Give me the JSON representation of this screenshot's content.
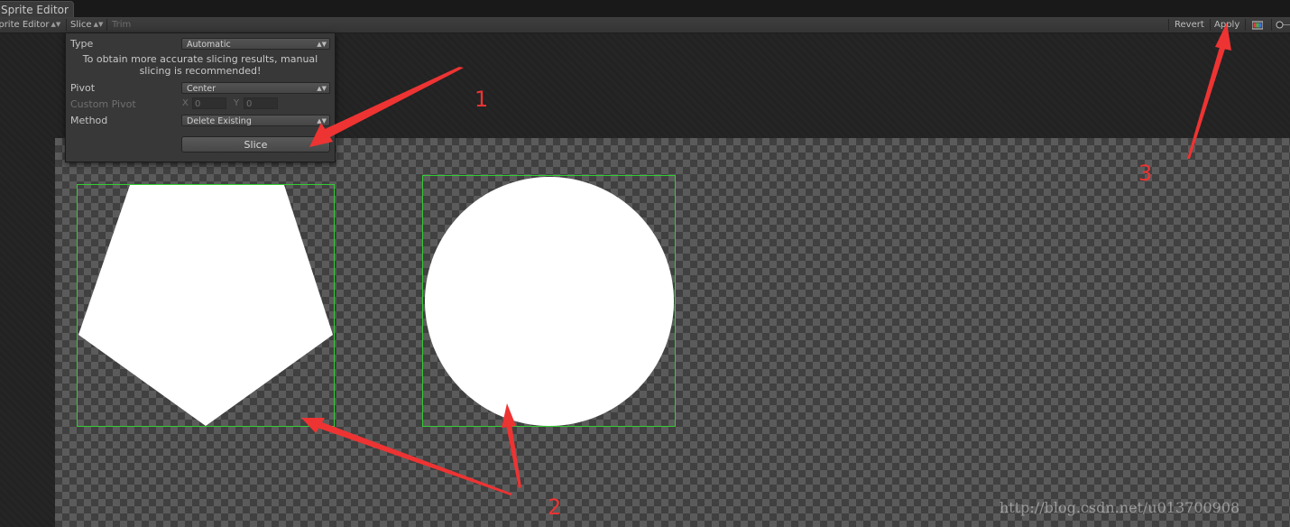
{
  "window": {
    "tab_title": "Sprite Editor"
  },
  "toolbar": {
    "editor_mode": "Sprite Editor",
    "slice_label": "Slice",
    "trim_label": "Trim",
    "revert_label": "Revert",
    "apply_label": "Apply"
  },
  "slice_popup": {
    "type_label": "Type",
    "type_value": "Automatic",
    "note": "To obtain more accurate slicing results, manual slicing is recommended!",
    "pivot_label": "Pivot",
    "pivot_value": "Center",
    "custom_pivot_label": "Custom Pivot",
    "x_label": "X",
    "x_value": "0",
    "y_label": "Y",
    "y_value": "0",
    "method_label": "Method",
    "method_value": "Delete Existing",
    "slice_button": "Slice"
  },
  "sprites": [
    {
      "shape": "pentagon",
      "fill": "#ffffff"
    },
    {
      "shape": "circle",
      "fill": "#ffffff"
    }
  ],
  "colors": {
    "selection_outline": "#33cc33",
    "annotation": "#ee3333"
  },
  "annotations": [
    "1",
    "2",
    "3"
  ],
  "watermark": "http://blog.csdn.net/u013700908"
}
